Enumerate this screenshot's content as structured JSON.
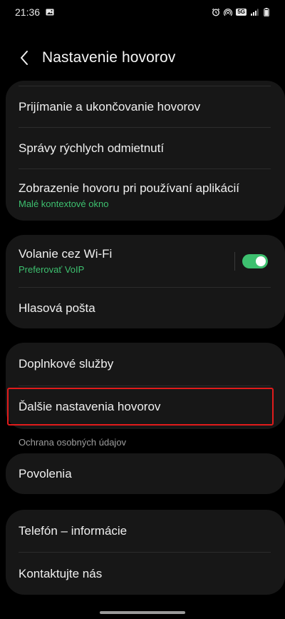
{
  "status": {
    "time": "21:36",
    "network": "5G",
    "icons": [
      "image-icon",
      "alarm-icon",
      "hotspot-icon",
      "volte-icon",
      "signal-icon",
      "battery-icon"
    ]
  },
  "header": {
    "title": "Nastavenie hovorov",
    "back_icon": "chevron-left-icon"
  },
  "group1": [
    {
      "label": "Prijímanie a ukončovanie hovorov"
    },
    {
      "label": "Správy rýchlych odmietnutí"
    },
    {
      "label": "Zobrazenie hovoru pri používaní aplikácií",
      "sub": "Malé kontextové okno"
    }
  ],
  "group2": [
    {
      "label": "Volanie cez Wi-Fi",
      "sub": "Preferovať VoIP",
      "toggle_on": true
    },
    {
      "label": "Hlasová pošta"
    }
  ],
  "group3": [
    {
      "label": "Doplnkové služby"
    },
    {
      "label": "Ďalšie nastavenia hovorov"
    }
  ],
  "section_privacy": "Ochrana osobných údajov",
  "group4": [
    {
      "label": "Povolenia"
    }
  ],
  "group5": [
    {
      "label": "Telefón – informácie"
    },
    {
      "label": "Kontaktujte nás"
    }
  ],
  "colors": {
    "accent_green": "#3dc06f",
    "highlight_red": "#e11b1b",
    "card_bg": "#171717",
    "page_bg": "#000000"
  }
}
